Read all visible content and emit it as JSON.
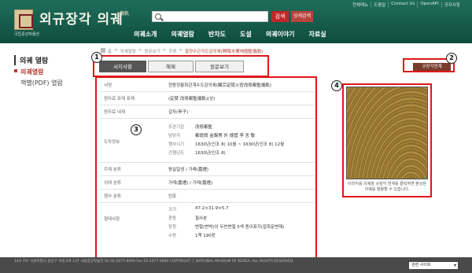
{
  "header": {
    "logo_sub": "국립중앙박물관",
    "title": "외규장각 의궤",
    "title_hanja": "儀軌",
    "top_links": [
      "전체메뉴",
      "도움말",
      "Contact Us",
      "OpenAPI",
      "공지사항"
    ],
    "search": {
      "value": "",
      "placeholder": ""
    },
    "search_button": "검색",
    "detail_button": "상세검색",
    "nav": [
      "의궤소개",
      "의궤열람",
      "반차도",
      "도설",
      "의궤이야기",
      "자료실"
    ]
  },
  "sidebar": {
    "title": "의궤 열람",
    "items": [
      "의궤열람",
      "책별(PDF) 열람"
    ]
  },
  "breadcrumb": [
    "홈",
    "의궤열람",
    "원문보기",
    "주류",
    "흥양수군지도감의궤(興陽水軍地圖監儀軌)"
  ],
  "tabs": [
    "서지사항",
    "해제",
    "원문보기"
  ],
  "tree_button": "규장각연계",
  "badges": [
    "1",
    "2",
    "3",
    "4"
  ],
  "table": {
    "rows": [
      {
        "label": "서명",
        "value": "현종정릉화관개수도감의궤(顯宗定陵火官改修都監儀軌)"
      },
      {
        "label": "원자료 표제 표제",
        "value": "(定陵 改修都監儀軌)(상)"
      },
      {
        "label": "원자료 내제",
        "value": "갑자(甲子)"
      }
    ],
    "info_label": "도작정보",
    "info": [
      {
        "label": "주관기관",
        "value": "改修都監"
      },
      {
        "label": "담당자",
        "value": "都提調 金錫冑 外 摠管 李 종 敬"
      },
      {
        "label": "행사시기",
        "value": "1630년(인조 8) 10월 ~ 1630년(인조 8) 12월"
      },
      {
        "label": "간행년도",
        "value": "1630년(인조 8)"
      }
    ],
    "rows2": [
      {
        "label": "주제 분류",
        "value": "왕실일생 / 가례(嘉禮)"
      },
      {
        "label": "의례 분류",
        "value": "가례(嘉禮) / 가례(嘉禮)"
      },
      {
        "label": "행사 분류",
        "value": "인조"
      }
    ],
    "physical_label": "형태사항",
    "physical": [
      {
        "label": "크기",
        "value": "47.2×31.9×5.7"
      },
      {
        "label": "판종",
        "value": "필사본"
      },
      {
        "label": "장정",
        "value": "변철(변박)이 두번변철 5색 종이표지(잡화문변재)"
      },
      {
        "label": "수량",
        "value": "1책 190장"
      }
    ]
  },
  "image_caption": "이미지를 의궤장 규장각 연계를 클릭하면 분상된 의궤를 열람할 수 있습니다.",
  "footer": {
    "text": "140-797 서울특별시 용산구 서빙고로 137 국립중앙박물관 Tel 02-2077-9000 Fax 02-2077-9000 COPYRIGHT ⓒ NATIONAL MUSEUM OF KOREA. ALL RIGHTS RESERVED.",
    "related_sites": "관련 사이트"
  }
}
